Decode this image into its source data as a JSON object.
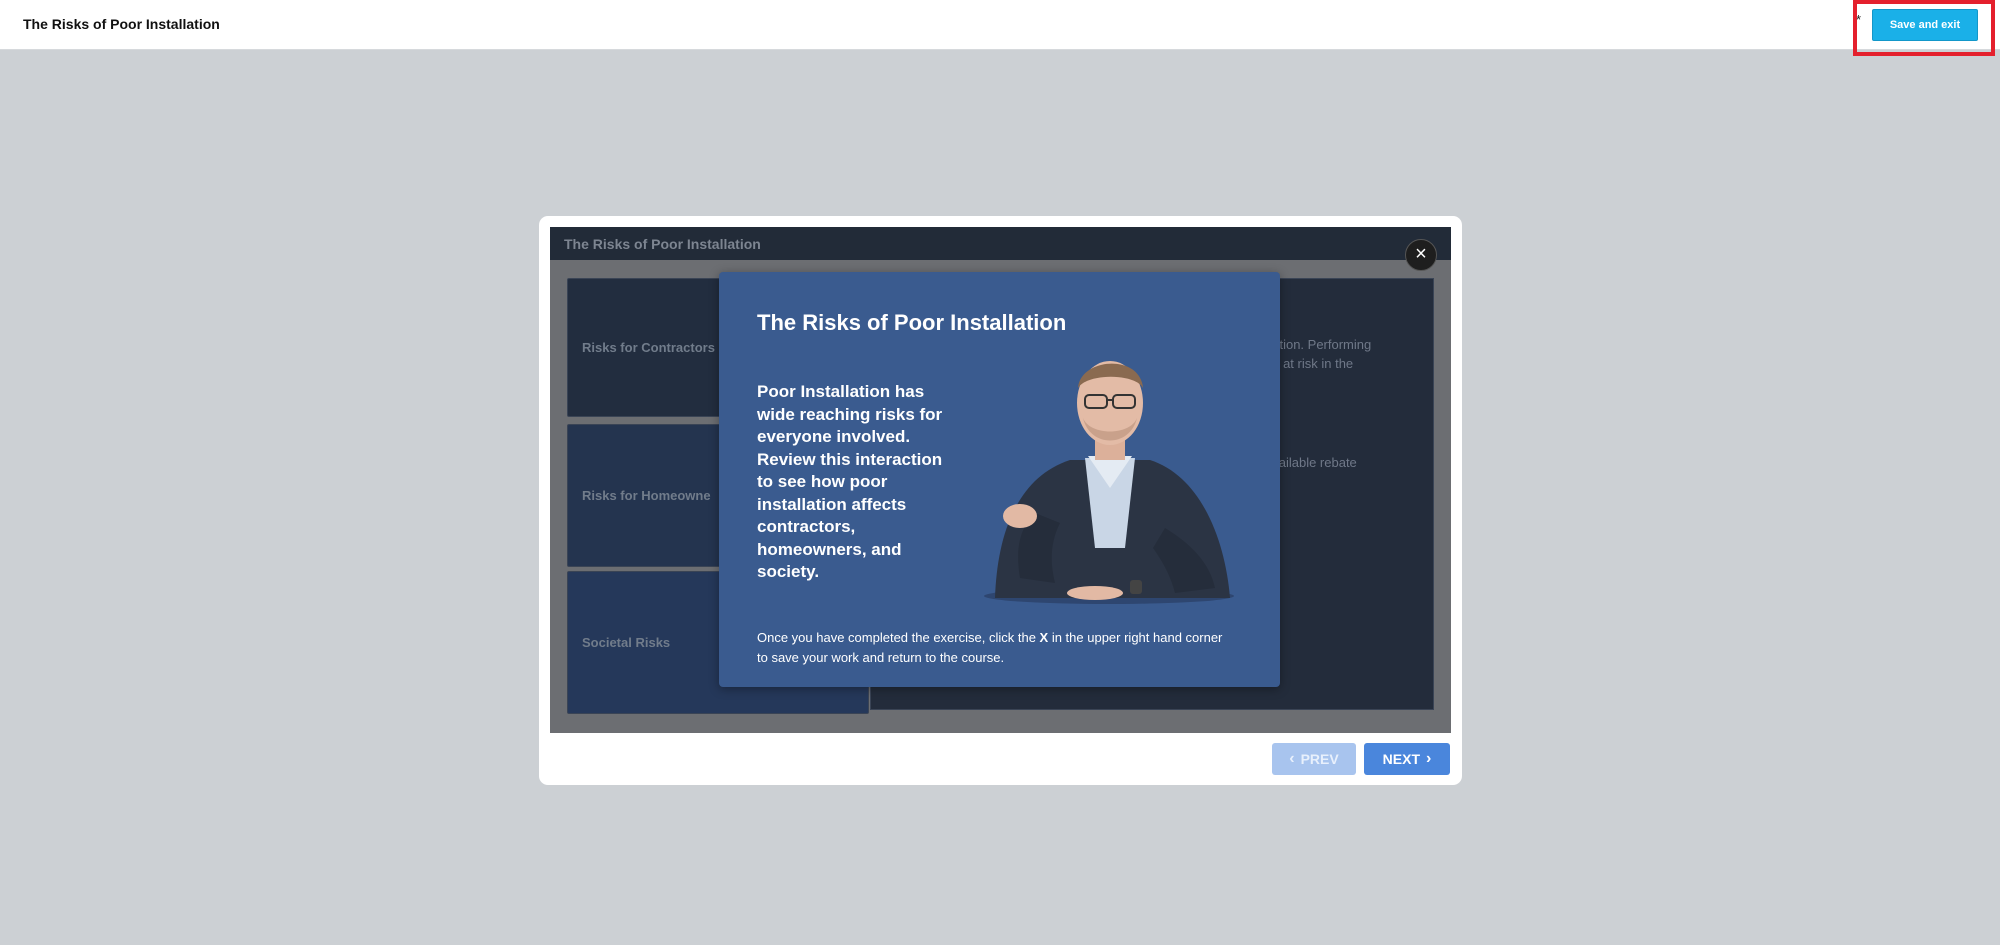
{
  "topbar": {
    "title": "The Risks of Poor Installation",
    "asterisk": "*",
    "save_label": "Save and exit"
  },
  "stage": {
    "header_title": "The Risks of Poor Installation",
    "tabs": [
      {
        "label": "Risks for Contractors"
      },
      {
        "label": "Risks for Homeowne"
      },
      {
        "label": "Societal Risks"
      }
    ],
    "panel_text_1": "eption. Performing\nou at risk in the",
    "panel_text_2": "available rebate"
  },
  "close_label": "×",
  "modal": {
    "title": "The Risks of Poor Installation",
    "body": "Poor Installation has wide reaching risks for everyone involved. Review this interaction to see how poor installation affects contractors, homeowners, and society.",
    "note_before": "Once you have completed the exercise, click the ",
    "note_bold": "X",
    "note_after": " in the upper right hand corner to save your work and return to the course."
  },
  "nav": {
    "prev_label": "PREV",
    "next_label": "NEXT"
  },
  "colors": {
    "save_button": "#1ab0e8",
    "highlight": "#e4202d",
    "modal_bg": "#3a5b8f",
    "next_button": "#4a86dc"
  }
}
